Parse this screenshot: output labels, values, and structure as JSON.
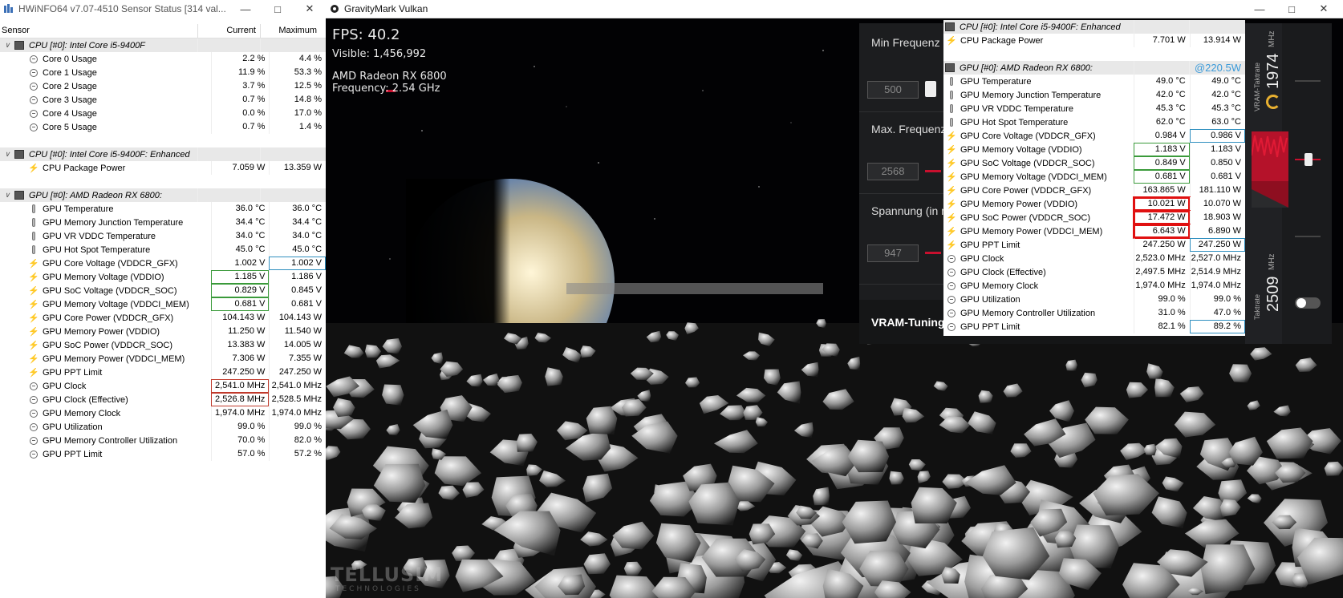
{
  "hwinfo": {
    "title": "HWiNFO64 v7.07-4510 Sensor Status [314 val...",
    "columns": {
      "sensor": "Sensor",
      "current": "Current",
      "maximum": "Maximum"
    },
    "rows": [
      {
        "type": "group",
        "label": "CPU [#0]: Intel Core i5-9400F"
      },
      {
        "type": "item",
        "icon": "circle",
        "label": "Core 0 Usage",
        "cur": "2.2 %",
        "max": "4.4 %"
      },
      {
        "type": "item",
        "icon": "circle",
        "label": "Core 1 Usage",
        "cur": "11.9 %",
        "max": "53.3 %"
      },
      {
        "type": "item",
        "icon": "circle",
        "label": "Core 2 Usage",
        "cur": "3.7 %",
        "max": "12.5 %"
      },
      {
        "type": "item",
        "icon": "circle",
        "label": "Core 3 Usage",
        "cur": "0.7 %",
        "max": "14.8 %"
      },
      {
        "type": "item",
        "icon": "circle",
        "label": "Core 4 Usage",
        "cur": "0.0 %",
        "max": "17.0 %"
      },
      {
        "type": "item",
        "icon": "circle",
        "label": "Core 5 Usage",
        "cur": "0.7 %",
        "max": "1.4 %"
      },
      {
        "type": "blank"
      },
      {
        "type": "group",
        "label": "CPU [#0]: Intel Core i5-9400F: Enhanced"
      },
      {
        "type": "item",
        "icon": "bolt",
        "label": "CPU Package Power",
        "cur": "7.059 W",
        "max": "13.359 W"
      },
      {
        "type": "blank"
      },
      {
        "type": "group",
        "label": "GPU [#0]: AMD Radeon RX 6800:"
      },
      {
        "type": "item",
        "icon": "therm",
        "label": "GPU Temperature",
        "cur": "36.0 °C",
        "max": "36.0 °C"
      },
      {
        "type": "item",
        "icon": "therm",
        "label": "GPU Memory Junction Temperature",
        "cur": "34.4 °C",
        "max": "34.4 °C"
      },
      {
        "type": "item",
        "icon": "therm",
        "label": "GPU VR VDDC Temperature",
        "cur": "34.0 °C",
        "max": "34.0 °C"
      },
      {
        "type": "item",
        "icon": "therm",
        "label": "GPU Hot Spot Temperature",
        "cur": "45.0 °C",
        "max": "45.0 °C"
      },
      {
        "type": "item",
        "icon": "bolt",
        "label": "GPU Core Voltage (VDDCR_GFX)",
        "cur": "1.002 V",
        "max": "1.002 V",
        "maxbox": "blue"
      },
      {
        "type": "item",
        "icon": "bolt",
        "label": "GPU Memory Voltage (VDDIO)",
        "cur": "1.185 V",
        "max": "1.186 V",
        "curbox": "green"
      },
      {
        "type": "item",
        "icon": "bolt",
        "label": "GPU SoC Voltage (VDDCR_SOC)",
        "cur": "0.829 V",
        "max": "0.845 V",
        "curbox": "green"
      },
      {
        "type": "item",
        "icon": "bolt",
        "label": "GPU Memory Voltage (VDDCI_MEM)",
        "cur": "0.681 V",
        "max": "0.681 V",
        "curbox": "green"
      },
      {
        "type": "item",
        "icon": "bolt",
        "label": "GPU Core Power (VDDCR_GFX)",
        "cur": "104.143 W",
        "max": "104.143 W"
      },
      {
        "type": "item",
        "icon": "bolt",
        "label": "GPU Memory Power (VDDIO)",
        "cur": "11.250 W",
        "max": "11.540 W"
      },
      {
        "type": "item",
        "icon": "bolt",
        "label": "GPU SoC Power (VDDCR_SOC)",
        "cur": "13.383 W",
        "max": "14.005 W"
      },
      {
        "type": "item",
        "icon": "bolt",
        "label": "GPU Memory Power (VDDCI_MEM)",
        "cur": "7.306 W",
        "max": "7.355 W"
      },
      {
        "type": "item",
        "icon": "bolt",
        "label": "GPU PPT Limit",
        "cur": "247.250 W",
        "max": "247.250 W"
      },
      {
        "type": "item",
        "icon": "circle",
        "label": "GPU Clock",
        "cur": "2,541.0 MHz",
        "max": "2,541.0 MHz",
        "curbox": "red"
      },
      {
        "type": "item",
        "icon": "circle",
        "label": "GPU Clock (Effective)",
        "cur": "2,526.8 MHz",
        "max": "2,528.5 MHz",
        "curbox": "red"
      },
      {
        "type": "item",
        "icon": "circle",
        "label": "GPU Memory Clock",
        "cur": "1,974.0 MHz",
        "max": "1,974.0 MHz"
      },
      {
        "type": "item",
        "icon": "circle",
        "label": "GPU Utilization",
        "cur": "99.0 %",
        "max": "99.0 %"
      },
      {
        "type": "item",
        "icon": "circle",
        "label": "GPU Memory Controller Utilization",
        "cur": "70.0 %",
        "max": "82.0 %"
      },
      {
        "type": "item",
        "icon": "circle",
        "label": "GPU PPT Limit",
        "cur": "57.0 %",
        "max": "57.2 %"
      }
    ]
  },
  "gravitymark": {
    "title": "GravityMark Vulkan",
    "fps": "FPS: 40.2",
    "visible": "Visible: 1,456,992",
    "gpu": "AMD Radeon RX 6800",
    "frequency": "Frequency: 2.54 GHz",
    "logo": "TELLUSIM",
    "logo_sub": "TECHNOLOGIES"
  },
  "tuning": {
    "min_label": "Min Frequenz",
    "min_value": "500",
    "max_label": "Max. Frequenz",
    "max_value": "2568",
    "volt_label": "Spannung (in m",
    "volt_value": "947",
    "vram_label": "VRAM-Tuning",
    "side_top_value": "1974",
    "side_top_unit": "MHz",
    "side_top_label": "VRAM-Taktrate",
    "side_bot_value": "2509",
    "side_bot_unit": "MHz",
    "side_bot_label": "Taktrate"
  },
  "overlay": {
    "ppt_badge": "@220.5W",
    "rows": [
      {
        "type": "group",
        "label": "CPU [#0]: Intel Core i5-9400F: Enhanced"
      },
      {
        "type": "item",
        "icon": "bolt",
        "label": "CPU Package Power",
        "cur": "7.701 W",
        "max": "13.914 W"
      },
      {
        "type": "blank"
      },
      {
        "type": "group",
        "label": "GPU [#0]: AMD Radeon RX 6800:",
        "badge": true
      },
      {
        "type": "item",
        "icon": "therm",
        "label": "GPU Temperature",
        "cur": "49.0 °C",
        "max": "49.0 °C"
      },
      {
        "type": "item",
        "icon": "therm",
        "label": "GPU Memory Junction Temperature",
        "cur": "42.0 °C",
        "max": "42.0 °C"
      },
      {
        "type": "item",
        "icon": "therm",
        "label": "GPU VR VDDC Temperature",
        "cur": "45.3 °C",
        "max": "45.3 °C"
      },
      {
        "type": "item",
        "icon": "therm",
        "label": "GPU Hot Spot Temperature",
        "cur": "62.0 °C",
        "max": "63.0 °C"
      },
      {
        "type": "item",
        "icon": "bolt",
        "label": "GPU Core Voltage (VDDCR_GFX)",
        "cur": "0.984 V",
        "max": "0.986 V",
        "maxbox": "blue"
      },
      {
        "type": "item",
        "icon": "bolt",
        "label": "GPU Memory Voltage (VDDIO)",
        "cur": "1.183 V",
        "max": "1.183 V",
        "curbox": "green"
      },
      {
        "type": "item",
        "icon": "bolt",
        "label": "GPU SoC Voltage (VDDCR_SOC)",
        "cur": "0.849 V",
        "max": "0.850 V",
        "curbox": "green"
      },
      {
        "type": "item",
        "icon": "bolt",
        "label": "GPU Memory Voltage (VDDCI_MEM)",
        "cur": "0.681 V",
        "max": "0.681 V",
        "curbox": "green"
      },
      {
        "type": "item",
        "icon": "bolt",
        "label": "GPU Core Power (VDDCR_GFX)",
        "cur": "163.865 W",
        "max": "181.110 W"
      },
      {
        "type": "item",
        "icon": "bolt",
        "label": "GPU Memory Power (VDDIO)",
        "cur": "10.021 W",
        "max": "10.070 W",
        "curbox": "red-thick"
      },
      {
        "type": "item",
        "icon": "bolt",
        "label": "GPU SoC Power (VDDCR_SOC)",
        "cur": "17.472 W",
        "max": "18.903 W",
        "curbox": "red-thick"
      },
      {
        "type": "item",
        "icon": "bolt",
        "label": "GPU Memory Power (VDDCI_MEM)",
        "cur": "6.643 W",
        "max": "6.890 W",
        "curbox": "red-thick"
      },
      {
        "type": "item",
        "icon": "bolt",
        "label": "GPU PPT Limit",
        "cur": "247.250 W",
        "max": "247.250 W",
        "maxbox": "blue"
      },
      {
        "type": "item",
        "icon": "circle",
        "label": "GPU Clock",
        "cur": "2,523.0 MHz",
        "max": "2,527.0 MHz"
      },
      {
        "type": "item",
        "icon": "circle",
        "label": "GPU Clock (Effective)",
        "cur": "2,497.5 MHz",
        "max": "2,514.9 MHz"
      },
      {
        "type": "item",
        "icon": "circle",
        "label": "GPU Memory Clock",
        "cur": "1,974.0 MHz",
        "max": "1,974.0 MHz"
      },
      {
        "type": "item",
        "icon": "circle",
        "label": "GPU Utilization",
        "cur": "99.0 %",
        "max": "99.0 %"
      },
      {
        "type": "item",
        "icon": "circle",
        "label": "GPU Memory Controller Utilization",
        "cur": "31.0 %",
        "max": "47.0 %"
      },
      {
        "type": "item",
        "icon": "circle",
        "label": "GPU PPT Limit",
        "cur": "82.1 %",
        "max": "89.2 %",
        "maxbox": "blue"
      }
    ]
  },
  "colors": {
    "accent_red": "#c8102e",
    "ppt_badge": "#3a9ad9",
    "hud_text": "#e8e8e8"
  }
}
